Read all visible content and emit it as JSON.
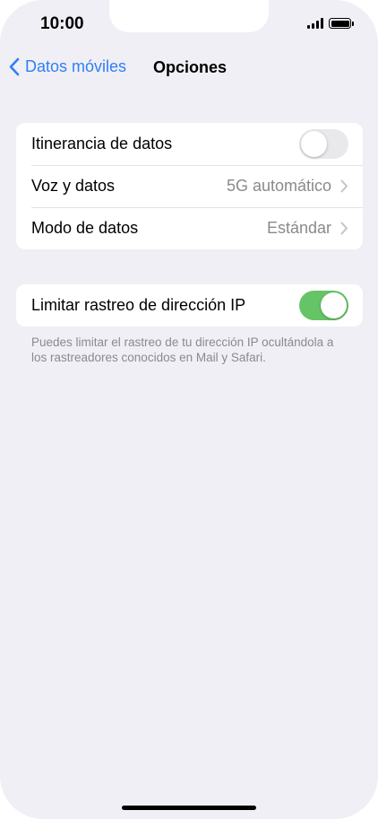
{
  "status_bar": {
    "time": "10:00",
    "icons": [
      "cellular-signal-icon",
      "battery-icon"
    ]
  },
  "nav": {
    "back_label": "Datos móviles",
    "title": "Opciones"
  },
  "group1": {
    "rows": [
      {
        "label": "Itinerancia de datos",
        "type": "toggle",
        "on": false
      },
      {
        "label": "Voz y datos",
        "value": "5G automático",
        "type": "disclosure"
      },
      {
        "label": "Modo de datos",
        "value": "Estándar",
        "type": "disclosure"
      }
    ]
  },
  "group2": {
    "rows": [
      {
        "label": "Limitar rastreo de dirección IP",
        "type": "toggle",
        "on": true
      }
    ],
    "footnote": "Puedes limitar el rastreo de tu dirección IP ocultándola a los rastreadores conocidos en Mail y Safari."
  },
  "colors": {
    "accent": "#2f7ff6",
    "toggle_on": "#65c466",
    "toggle_off": "#e9e9eb",
    "background": "#f0eff5",
    "secondary_text": "#8a8a8e"
  }
}
